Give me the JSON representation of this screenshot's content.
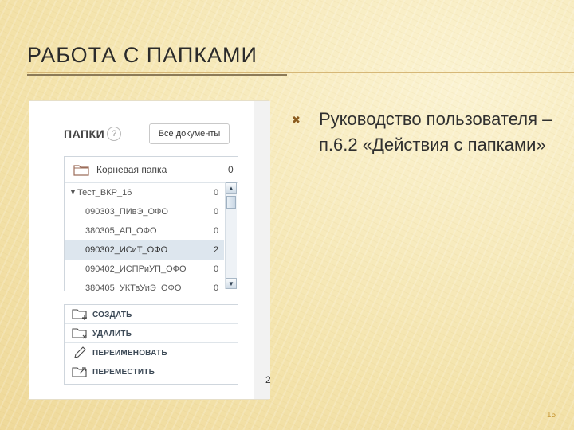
{
  "slide": {
    "title": "РАБОТА С ПАПКАМИ",
    "page_number": "15",
    "bullet": "Руководство пользователя – п.6.2 «Действия с папками»"
  },
  "panel": {
    "title": "ПАПКИ",
    "help_icon": "?",
    "all_docs_label": "Все документы",
    "root_folder": {
      "label": "Корневая папка",
      "count": "0"
    },
    "folders": [
      {
        "label": "Тест_ВКР_16",
        "count": "0",
        "expanded": true,
        "selected": false
      },
      {
        "label": "090303_ПИвЭ_ОФО",
        "count": "0",
        "selected": false
      },
      {
        "label": "380305_АП_ОФО",
        "count": "0",
        "selected": false
      },
      {
        "label": "090302_ИСиТ_ОФО",
        "count": "2",
        "selected": true
      },
      {
        "label": "090402_ИСПРиУП_ОФО",
        "count": "0",
        "selected": false
      },
      {
        "label": "380405_УКТвУиЭ_ОФО",
        "count": "0",
        "selected": false
      }
    ],
    "actions": [
      {
        "label": "СОЗДАТЬ",
        "icon": "folder-add-icon"
      },
      {
        "label": "УДАЛИТЬ",
        "icon": "folder-delete-icon"
      },
      {
        "label": "ПЕРЕИМЕНОВАТЬ",
        "icon": "pencil-icon"
      },
      {
        "label": "ПЕРЕМЕСТИТЬ",
        "icon": "folder-move-icon"
      }
    ],
    "edge_number": "2"
  },
  "colors": {
    "selected_row": "#dde6ee",
    "folder_stroke": "#9c6d5a",
    "bullet_icon": "#8a5b1f"
  }
}
